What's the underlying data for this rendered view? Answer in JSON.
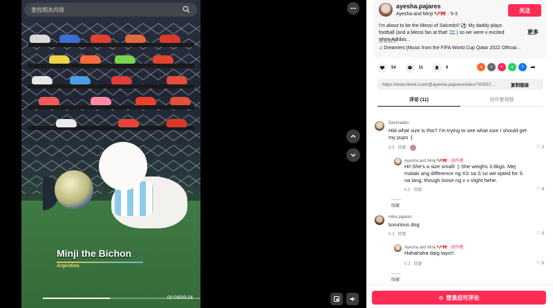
{
  "video": {
    "search_placeholder": "查找相关内容",
    "title": "Minji the Bichon",
    "subtitle": "Argentina",
    "time": "00:09/00:24",
    "progress": 0.375
  },
  "post": {
    "username": "ayesha.pajares",
    "subname": "Ayesha and Minji 🐶🎀 · 5-3",
    "follow_label": "关注",
    "caption": "I'm about to be the Messi of Salcedo!! ⚽ My daddy plays football (and a Messi fan at that! 🇦🇷 ) so we were v excited when Adidas...",
    "more_label": "更多",
    "translate_label": "查看翻译",
    "music": "Dreamers [Music from the FIFA World Cup Qatar 2022 Official...",
    "likes": "54",
    "comments": "11",
    "saves": "6",
    "link": "https://www.tiktok.com/@ayesha.pajares/video/763557...",
    "copy_label": "复制链接"
  },
  "tabs": [
    {
      "label": "评论 (11)",
      "active": true
    },
    {
      "label": "创作者视频",
      "active": false
    }
  ],
  "comments": [
    {
      "name": "Davinaaiko",
      "text": "Hiiii what size is this? I'm trying to see what size I should get my pups :(",
      "date": "5-5",
      "reply_label": "回复",
      "likes": "1",
      "reply": {
        "name": "Ayesha and Minji 🐶🎀",
        "creator_tag": "· 创作者",
        "text": "Hi! She's a size small! :) She weighs 3.6kgs. Mej malaki ang difference ng XS sa S so we opted for S na lang, though loose ng v v slight hehe.",
        "date": "5-5",
        "reply_label": "回复",
        "likes": "0"
      },
      "collapse_label": "隐藏"
    },
    {
      "name": "mika pajares",
      "text": "luxurious dog",
      "date": "5-3",
      "reply_label": "回复",
      "likes": "0",
      "reply": {
        "name": "Ayesha and Minji 🐶🎀",
        "creator_tag": "· 创作者",
        "text": "Hahahaha daig tayo!!",
        "date": "5-3",
        "reply_label": "回复",
        "likes": "0"
      },
      "collapse_label": "隐藏"
    }
  ],
  "login_label": "登录后可评论",
  "colors": {
    "accent": "#fe2c55"
  }
}
